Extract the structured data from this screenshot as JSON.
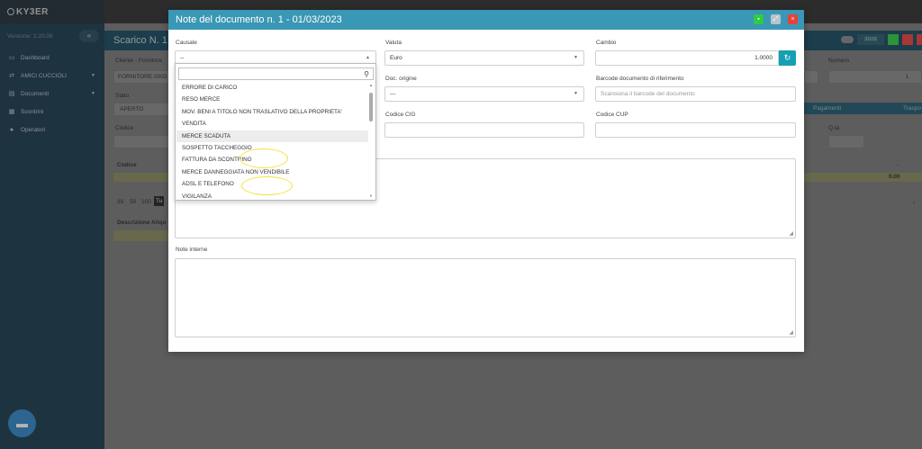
{
  "sidebar": {
    "logo": "KY3ER",
    "version": "Versione: 2.20.06",
    "collapse": "«",
    "items": [
      {
        "label": "Dashboard",
        "icon": "laptop-icon"
      },
      {
        "label": "AMICI CUCCIOLI",
        "icon": "truck-icon"
      },
      {
        "label": "Documenti",
        "icon": "document-icon"
      },
      {
        "label": "Scontrini",
        "icon": "receipt-icon"
      },
      {
        "label": "Operatori",
        "icon": "user-icon"
      }
    ]
  },
  "background": {
    "title": "Scarico N. 1",
    "cliente_label": "Cliente - Fornitore",
    "cliente_value": "FORNITORE 0003",
    "stato_label": "Stato",
    "stato_value": "APERTO",
    "codice_label": "Codice",
    "codice_col": "Codice",
    "paging": [
      "35",
      "50",
      "100",
      "Tu"
    ],
    "desc_aliquota": "Descrizione Aliqu",
    "badge": "31103",
    "numero_label": "Numero",
    "numero_value": "1",
    "pagamenti": "Pagamenti",
    "trasporto": "Traspo",
    "qta_label": "Q.tà",
    "dash": "-",
    "total": "0.00",
    "chevron": "‹"
  },
  "modal": {
    "title": "Note del documento n. 1 - 01/03/2023",
    "causale_label": "Causale",
    "causale_value": "--",
    "valuta_label": "Valuta",
    "valuta_value": "Euro",
    "cambio_label": "Cambio",
    "cambio_value": "1.0000",
    "doc_origine_label": "Doc. origine",
    "doc_origine_value": "---",
    "barcode_label": "Barcode documento di riferimento",
    "barcode_placeholder": "Scansiona il barcode del documento",
    "cig_label": "Codice CIG",
    "cup_label": "Codice CUP",
    "note_interne_label": "Note interne"
  },
  "dropdown": {
    "items": [
      "ERRORE DI CARICO",
      "RESO MERCE",
      "MOV. BENI A TITOLO NON TRASLATIVO DELLA PROPRIETA'",
      "VENDITA",
      "MERCE SCADUTA",
      "SOSPETTO TACCHEGGIO",
      "FATTURA DA SCONTRINO",
      "MERCE DANNEGGIATA NON VENDIBILE",
      "ADSL E TELEFONO",
      "VIGILANZA"
    ],
    "highlighted": 4
  },
  "colors": {
    "header": "#3a97b5",
    "sidebar": "#193a4d",
    "accent_teal": "#16a0b4",
    "annotation": "#f2e33a"
  }
}
